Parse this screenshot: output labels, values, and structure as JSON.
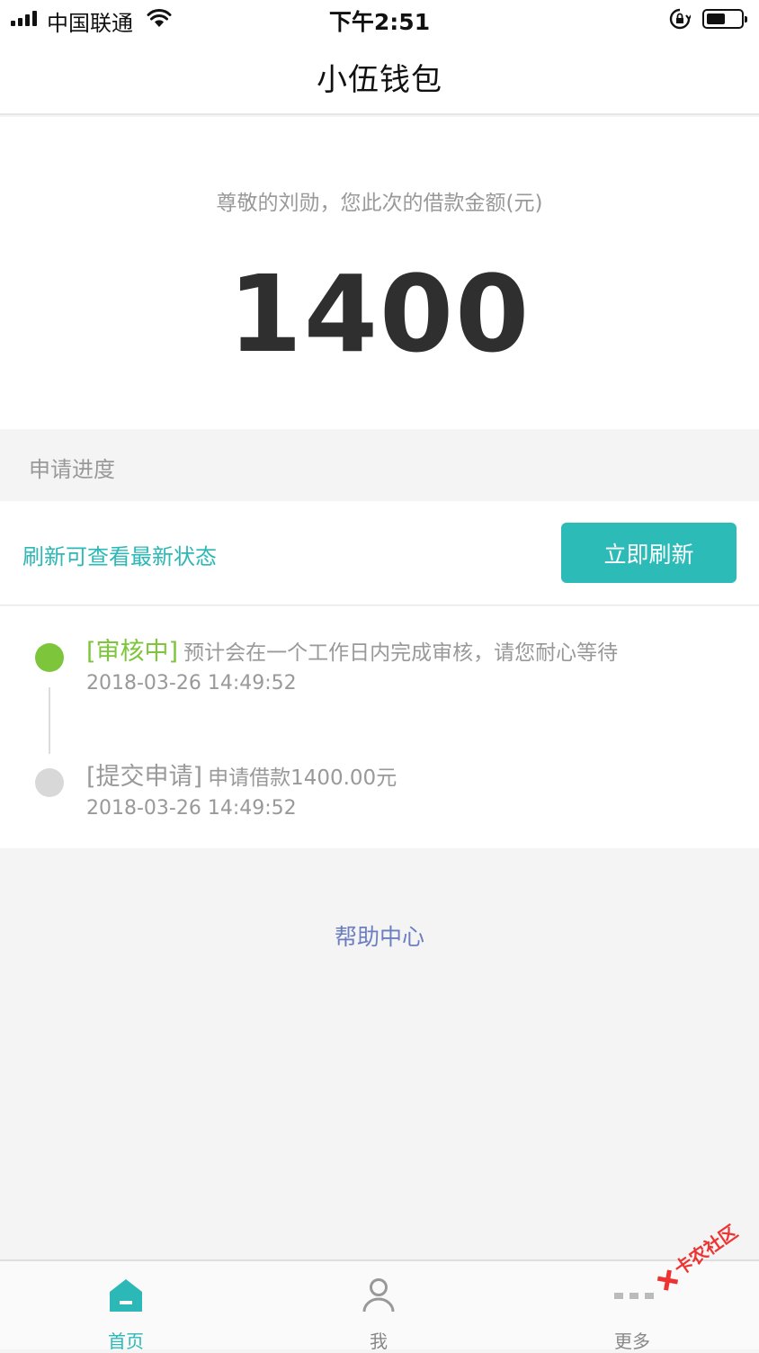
{
  "status_bar": {
    "carrier": "中国联通",
    "time": "下午2:51"
  },
  "nav": {
    "title": "小伍钱包"
  },
  "loan": {
    "subtitle": "尊敬的刘勋，您此次的借款金额(元)",
    "amount": "1400"
  },
  "progress": {
    "section_label": "申请进度",
    "refresh_hint": "刷新可查看最新状态",
    "refresh_button": "立即刷新",
    "steps": [
      {
        "tag": "[审核中]",
        "desc": "预计会在一个工作日内完成审核，请您耐心等待",
        "time": "2018-03-26 14:49:52",
        "color": "#7dc63b"
      },
      {
        "tag": "[提交申请]",
        "desc": "申请借款1400.00元",
        "time": "2018-03-26 14:49:52",
        "color": "#999999"
      }
    ]
  },
  "help_link": "帮助中心",
  "tabs": [
    {
      "label": "首页",
      "icon": "home-icon",
      "active": true
    },
    {
      "label": "我",
      "icon": "user-icon",
      "active": false
    },
    {
      "label": "更多",
      "icon": "more-icon",
      "active": false
    }
  ],
  "watermark": {
    "text": "卡农社区"
  },
  "colors": {
    "accent": "#2dbbb7",
    "active_step": "#7dc63b",
    "link": "#6c7ec0"
  }
}
